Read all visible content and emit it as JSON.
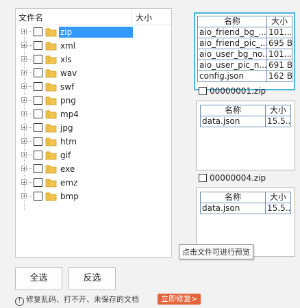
{
  "tree": {
    "header_name": "文件名",
    "header_size": "大小",
    "items": [
      {
        "label": "zip",
        "selected": true
      },
      {
        "label": "xml"
      },
      {
        "label": "xls"
      },
      {
        "label": "wav"
      },
      {
        "label": "swf"
      },
      {
        "label": "png"
      },
      {
        "label": "mp4"
      },
      {
        "label": "jpg"
      },
      {
        "label": "htm"
      },
      {
        "label": "gif"
      },
      {
        "label": "exe"
      },
      {
        "label": "emz"
      },
      {
        "label": "bmp"
      }
    ]
  },
  "preview": {
    "col_name": "名称",
    "col_size": "大小",
    "boxes": [
      {
        "title": "",
        "files": [
          {
            "name": "aio_friend_bg_...",
            "size": "101..."
          },
          {
            "name": "aio_friend_pic_...",
            "size": "695 B"
          },
          {
            "name": "aio_user_bg_no...",
            "size": "101..."
          },
          {
            "name": "aio_user_pic_n...",
            "size": "691 B"
          },
          {
            "name": "config.json",
            "size": "162 B"
          }
        ]
      },
      {
        "title": "00000001.zip",
        "files": [
          {
            "name": "data.json",
            "size": "15.5..."
          }
        ]
      },
      {
        "title": "00000004.zip",
        "files": [
          {
            "name": "data.json",
            "size": "15.5..."
          }
        ]
      }
    ]
  },
  "tooltip": "点击文件可进行预览",
  "buttons": {
    "select_all": "全选",
    "invert": "反选"
  },
  "footer": {
    "text": "修复乱码、打不开、未保存的文档",
    "repair": "立即修复>"
  },
  "colors": {
    "selection": "#3399ff",
    "active_border": "#49b6e6",
    "repair": "#e4643b",
    "folder": "#f2c44f"
  }
}
